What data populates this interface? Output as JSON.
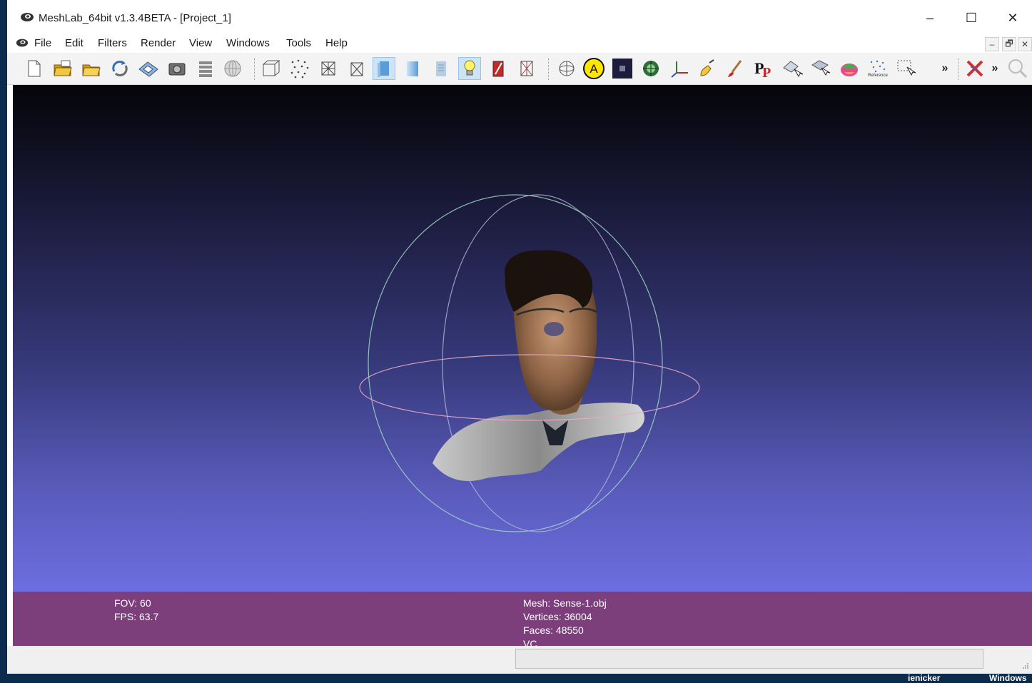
{
  "window": {
    "title": "MeshLab_64bit v1.3.4BETA - [Project_1]",
    "controls": {
      "minimize": "–",
      "maximize": "☐",
      "close": "✕"
    }
  },
  "menubar": {
    "items": [
      "File",
      "Edit",
      "Filters",
      "Render",
      "View",
      "Windows",
      "Tools",
      "Help"
    ],
    "mdi": {
      "minimize": "–",
      "restore": "🗗",
      "close": "✕"
    }
  },
  "toolbar": {
    "overflow": "»",
    "overflow2": "»",
    "reference_label": "Reference",
    "icons": [
      "new-project-icon",
      "open-project-icon",
      "open-mesh-icon",
      "reload-icon",
      "save-icon",
      "snapshot-icon",
      "layers-icon",
      "globe-icon",
      "bbox-icon",
      "points-icon",
      "wireframe-icon",
      "hidden-lines-icon",
      "flat-shading-icon",
      "smooth-shading-icon",
      "texture-icon",
      "light-icon",
      "back-face-icon",
      "selected-faces-icon",
      "trackball-icon",
      "annotation-icon",
      "dark-square-icon",
      "rasterize-icon",
      "axes-icon",
      "paint-icon",
      "brush-icon",
      "pp-icon",
      "select-vertices-icon",
      "select-faces-icon",
      "color-mesh-icon",
      "reference-icon",
      "select-region-icon",
      "delete-icon",
      "zoom-icon"
    ]
  },
  "viewport": {
    "background_top": "#050509",
    "background_bottom": "#6d6ee0"
  },
  "info": {
    "fov": "FOV: 60",
    "fps": "FPS:   63.7",
    "mesh": "Mesh: Sense-1.obj",
    "vertices": "Vertices: 36004",
    "faces": "Faces: 48550",
    "vc": "VC"
  },
  "taskbar": {
    "left": "ienicker",
    "right": "Windows"
  },
  "colors": {
    "info_bar": "#7c3f7c",
    "toolbar_active": "#cde4f7"
  }
}
